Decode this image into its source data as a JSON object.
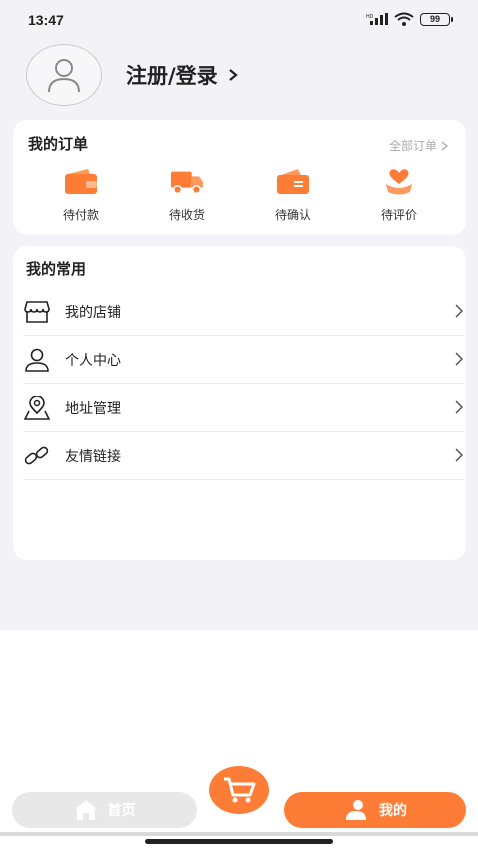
{
  "status": {
    "time": "13:47",
    "battery": "99"
  },
  "profile": {
    "login_label": "注册/登录"
  },
  "orders": {
    "title": "我的订单",
    "all_label": "全部订单",
    "items": [
      {
        "label": "待付款",
        "icon": "wallet-icon"
      },
      {
        "label": "待收货",
        "icon": "truck-icon"
      },
      {
        "label": "待确认",
        "icon": "card-confirm-icon"
      },
      {
        "label": "待评价",
        "icon": "heart-hand-icon"
      }
    ]
  },
  "common": {
    "title": "我的常用",
    "items": [
      {
        "label": "我的店铺",
        "icon": "store-icon"
      },
      {
        "label": "个人中心",
        "icon": "user-icon"
      },
      {
        "label": "地址管理",
        "icon": "location-icon"
      },
      {
        "label": "友情链接",
        "icon": "link-icon"
      }
    ]
  },
  "nav": {
    "home_label": "首页",
    "mine_label": "我的"
  },
  "colors": {
    "accent": "#fd7d36",
    "background": "#f2f2f7"
  }
}
